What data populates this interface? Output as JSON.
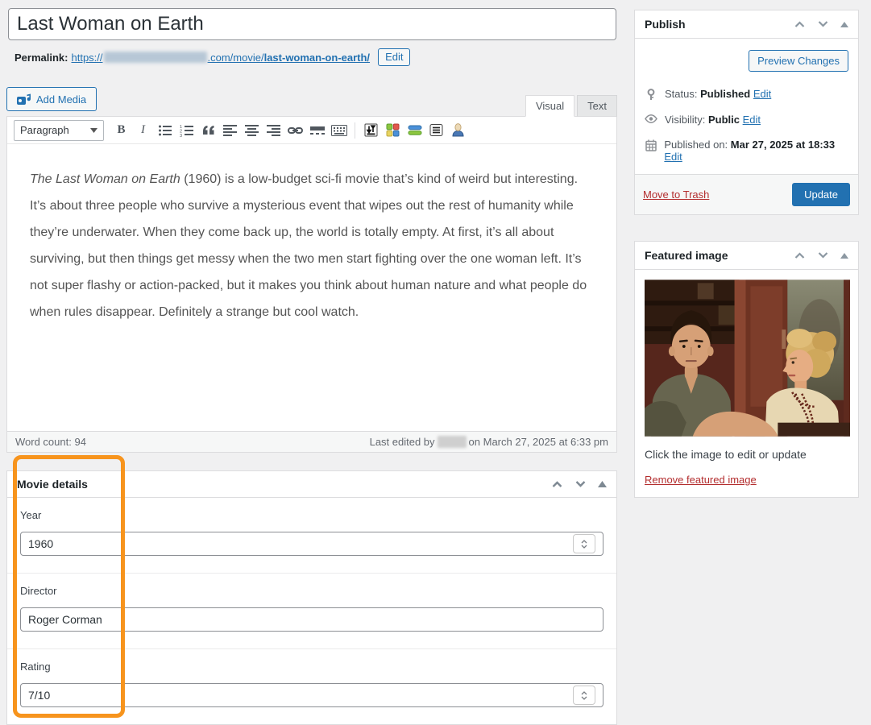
{
  "title_field": {
    "value": "Last Woman on Earth"
  },
  "permalink": {
    "label": "Permalink:",
    "url_prefix": "https://",
    "url_mid": ".com/movie/",
    "url_slug": "last-woman-on-earth/",
    "edit_button": "Edit"
  },
  "editor": {
    "add_media_label": "Add Media",
    "tabs": {
      "visual": "Visual",
      "text": "Text"
    },
    "format_dropdown": "Paragraph",
    "toolbar": {
      "bold_label": "B",
      "italic_label": "I",
      "icon_names": [
        "bold-icon",
        "italic-icon",
        "bulleted-list-icon",
        "numbered-list-icon",
        "blockquote-icon",
        "align-left-icon",
        "align-center-icon",
        "align-right-icon",
        "link-icon",
        "read-more-icon",
        "keyboard-icon",
        "page-break-icon",
        "layout-grid-icon",
        "horizontal-bars-icon",
        "notes-icon",
        "user-profile-icon"
      ]
    },
    "content": {
      "lead_italic": "The Last Woman on Earth",
      "body": " (1960) is a low-budget sci-fi movie that’s kind of weird but interesting. It’s about three people who survive a mysterious event that wipes out the rest of humanity while they’re underwater. When they come back up, the world is totally empty. At first, it’s all about surviving, but then things get messy when the two men start fighting over the one woman left. It’s not super flashy or action-packed, but it makes you think about human nature and what people do when rules disappear. Definitely a strange but cool watch."
    },
    "status_bar": {
      "word_count_label": "Word count:",
      "word_count_value": "94",
      "last_edited_prefix": "Last edited by",
      "last_edited_suffix": "on March 27, 2025 at 6:33 pm"
    }
  },
  "movie_details": {
    "title": "Movie details",
    "fields": [
      {
        "label": "Year",
        "value": "1960",
        "type": "number"
      },
      {
        "label": "Director",
        "value": "Roger Corman",
        "type": "text"
      },
      {
        "label": "Rating",
        "value": "7/10",
        "type": "number"
      }
    ]
  },
  "publish_panel": {
    "title": "Publish",
    "preview_button": "Preview Changes",
    "status": {
      "icon": "pin-icon",
      "label": "Status:",
      "value": "Published",
      "edit": "Edit"
    },
    "visibility": {
      "icon": "eye-icon",
      "label": "Visibility:",
      "value": "Public",
      "edit": "Edit"
    },
    "published_on": {
      "icon": "calendar-icon",
      "label": "Published on:",
      "value": "Mar 27, 2025 at 18:33",
      "edit": "Edit"
    },
    "move_to_trash": "Move to Trash",
    "update_button": "Update"
  },
  "featured_image_panel": {
    "title": "Featured image",
    "caption": "Click the image to edit or update",
    "remove_link": "Remove featured image"
  },
  "panel_controls": {
    "icon_names": [
      "move-up-icon",
      "move-down-icon",
      "toggle-panel-icon"
    ]
  },
  "colors": {
    "accent_blue": "#2271b1",
    "danger_red": "#b32d2e",
    "highlight_orange": "#f7941d",
    "background": "#f0f0f1",
    "panel_border": "#dcdcde"
  }
}
